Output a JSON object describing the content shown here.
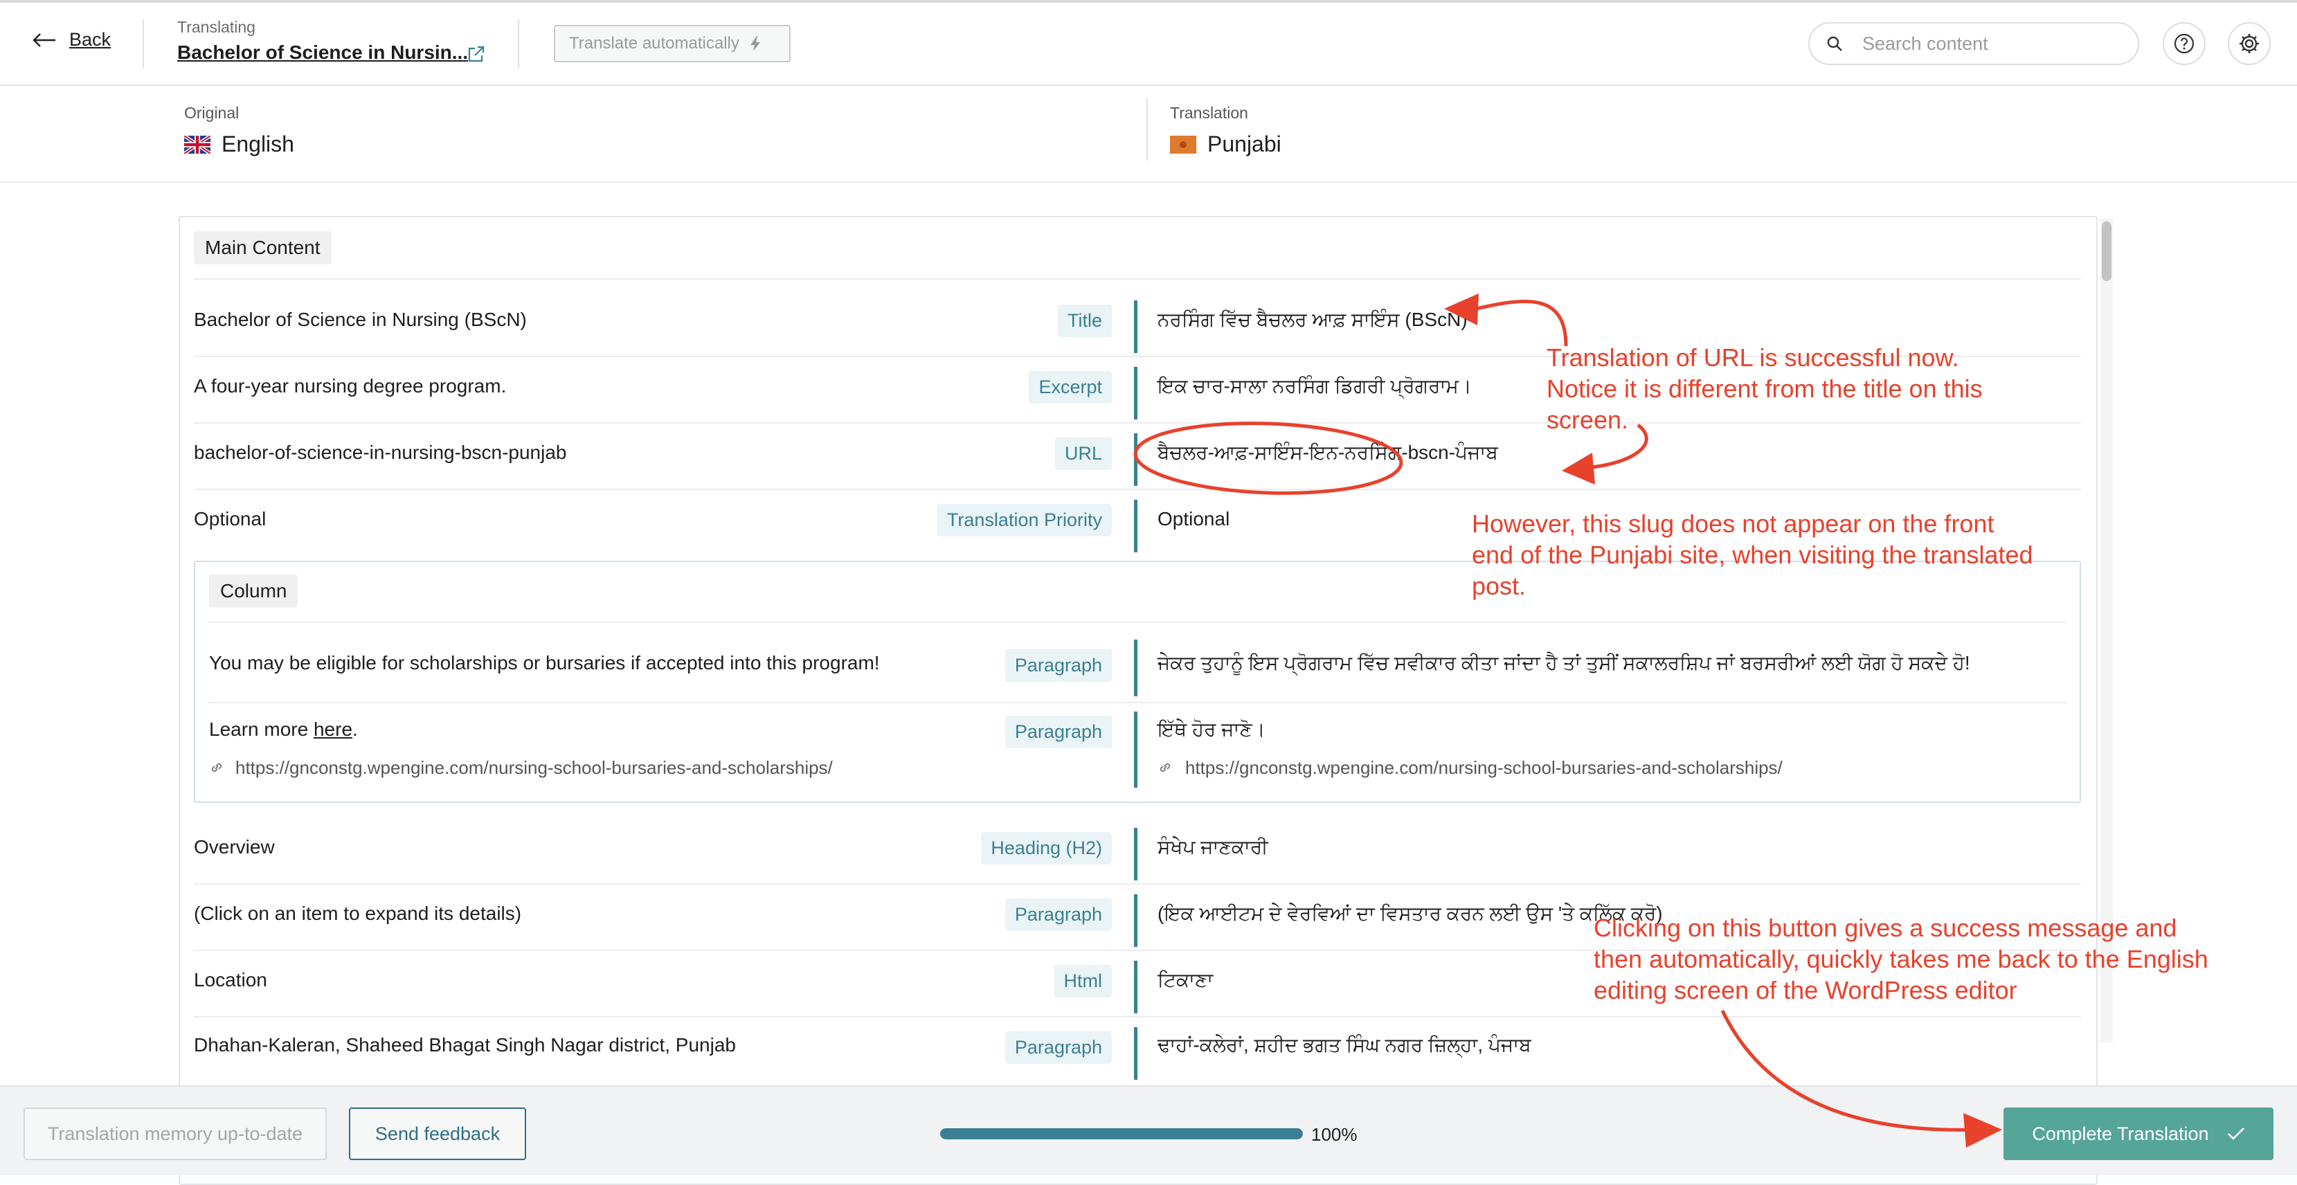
{
  "header": {
    "back_label": "Back",
    "translating_label": "Translating",
    "post_title": "Bachelor of Science in Nursin...",
    "auto_button": "Translate automatically",
    "search_placeholder": "Search content"
  },
  "languages": {
    "original_caption": "Original",
    "original_name": "English",
    "translation_caption": "Translation",
    "translation_name": "Punjabi"
  },
  "section": {
    "title": "Main Content"
  },
  "rows": [
    {
      "original": "Bachelor of Science in Nursing (BScN)",
      "type": "Title",
      "translation": "ਨਰਸਿੰਗ ਵਿੱਚ ਬੈਚਲਰ ਆਫ਼ ਸਾਇੰਸ (BScN)"
    },
    {
      "original": "A four-year nursing degree program.",
      "type": "Excerpt",
      "translation": "ਇਕ ਚਾਰ-ਸਾਲਾ ਨਰਸਿੰਗ ਡਿਗਰੀ ਪ੍ਰੋਗਰਾਮ।"
    },
    {
      "original": "bachelor-of-science-in-nursing-bscn-punjab",
      "type": "URL",
      "translation": "ਬੈਚਲਰ-ਆਫ਼-ਸਾਇੰਸ-ਇਨ-ਨਰਸਿੰਗ-bscn-ਪੰਜਾਬ"
    },
    {
      "original": "Optional",
      "type": "Translation Priority",
      "translation": "Optional"
    }
  ],
  "column": {
    "title": "Column",
    "rows": [
      {
        "original": "You may be eligible for scholarships or bursaries if accepted into this program!",
        "type": "Paragraph",
        "translation": "ਜੇਕਰ ਤੁਹਾਨੂੰ ਇਸ ਪ੍ਰੋਗਰਾਮ ਵਿੱਚ ਸਵੀਕਾਰ ਕੀਤਾ ਜਾਂਦਾ ਹੈ ਤਾਂ ਤੁਸੀਂ ਸਕਾਲਰਸ਼ਿਪ ਜਾਂ ਬਰਸਰੀਆਂ ਲਈ ਯੋਗ ਹੋ ਸਕਦੇ ਹੋ!"
      },
      {
        "original_prefix": "Learn more ",
        "original_link": "here",
        "original_suffix": ".",
        "type": "Paragraph",
        "translation": "ਇੱਥੇ ਹੋਰ ਜਾਣੋ।",
        "link_url": "https://gnconstg.wpengine.com/nursing-school-bursaries-and-scholarships/",
        "link_url_translation": "https://gnconstg.wpengine.com/nursing-school-bursaries-and-scholarships/"
      }
    ]
  },
  "rows2": [
    {
      "original": "Overview",
      "type": "Heading (H2)",
      "translation": "ਸੰਖੇਪ ਜਾਣਕਾਰੀ"
    },
    {
      "original": "(Click on an item to expand its details)",
      "type": "Paragraph",
      "translation": "(ਇਕ ਆਈਟਮ ਦੇ ਵੇਰਵਿਆਂ ਦਾ ਵਿਸਤਾਰ ਕਰਨ ਲਈ ਉਸ 'ਤੇ ਕਲਿੱਕ ਕਰੋ)"
    },
    {
      "original": "Location",
      "type": "Html",
      "translation": "ਟਿਕਾਣਾ"
    }
  ],
  "partial_row": {
    "original": "Dhahan-Kaleran, Shaheed Bhagat Singh Nagar district, Punjab",
    "type": "Paragraph",
    "translation": "ਢਾਹਾਂ-ਕਲੇਰਾਂ, ਸ਼ਹੀਦ ਭਗਤ ਸਿੰਘ ਨਗਰ ਜ਼ਿਲ੍ਹਾ, ਪੰਜਾਬ"
  },
  "footer": {
    "memory_button": "Translation memory up-to-date",
    "feedback_button": "Send feedback",
    "progress_value": 100,
    "progress_label": "100%",
    "complete_button": "Complete Translation"
  },
  "annotations": {
    "note1": [
      "Translation of URL is successful now.",
      "Notice it is different from the title on this",
      "screen."
    ],
    "note2": [
      "However, this slug does not appear on the front",
      "end of the Punjabi site, when visiting the translated",
      "post."
    ],
    "note3": [
      "Clicking on this button gives a success message and",
      "then automatically, quickly takes me back to the English",
      "editing screen of the WordPress editor"
    ],
    "color": "#e8412c"
  },
  "colors": {
    "accent": "#3a7f94",
    "complete_button": "#55a598",
    "badge_bg": "#eaf3f5"
  },
  "icons": {
    "back": "arrow-left-icon",
    "external": "external-link-icon",
    "auto": "lightning-icon",
    "search": "search-icon",
    "help": "help-icon",
    "settings": "gear-icon",
    "link": "link-icon",
    "check": "check-icon"
  }
}
